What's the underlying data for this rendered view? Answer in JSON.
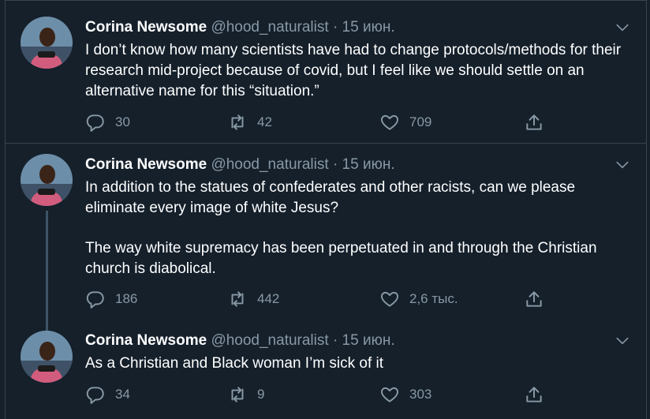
{
  "tweets": [
    {
      "name": "Corina Newsome",
      "handle": "@hood_naturalist",
      "separator": "·",
      "date": "15 июн.",
      "paragraphs": [
        "I don’t know how many scientists have had to change protocols/methods for their research mid-project because of covid, but I feel like we should settle on an alternative name for this “situation.”"
      ],
      "replies": "30",
      "retweets": "42",
      "likes": "709"
    },
    {
      "name": "Corina Newsome",
      "handle": "@hood_naturalist",
      "separator": "·",
      "date": "15 июн.",
      "paragraphs": [
        "In addition to the statues of confederates and other racists, can we please eliminate every image of white Jesus?",
        "The way white supremacy has been perpetuated in and through the Christian church is diabolical."
      ],
      "replies": "186",
      "retweets": "442",
      "likes": "2,6 тыс."
    },
    {
      "name": "Corina Newsome",
      "handle": "@hood_naturalist",
      "separator": "·",
      "date": "15 июн.",
      "paragraphs": [
        "As a Christian and Black woman I’m sick of it"
      ],
      "replies": "34",
      "retweets": "9",
      "likes": "303"
    }
  ],
  "icons": {
    "reply": "reply-icon",
    "retweet": "retweet-icon",
    "like": "heart-icon",
    "share": "share-icon",
    "menu": "chevron-down-icon"
  },
  "colors": {
    "background": "#15202b",
    "border": "#38444d",
    "text_primary": "#ffffff",
    "text_secondary": "#8899a6",
    "thread_line": "#3d5466"
  }
}
